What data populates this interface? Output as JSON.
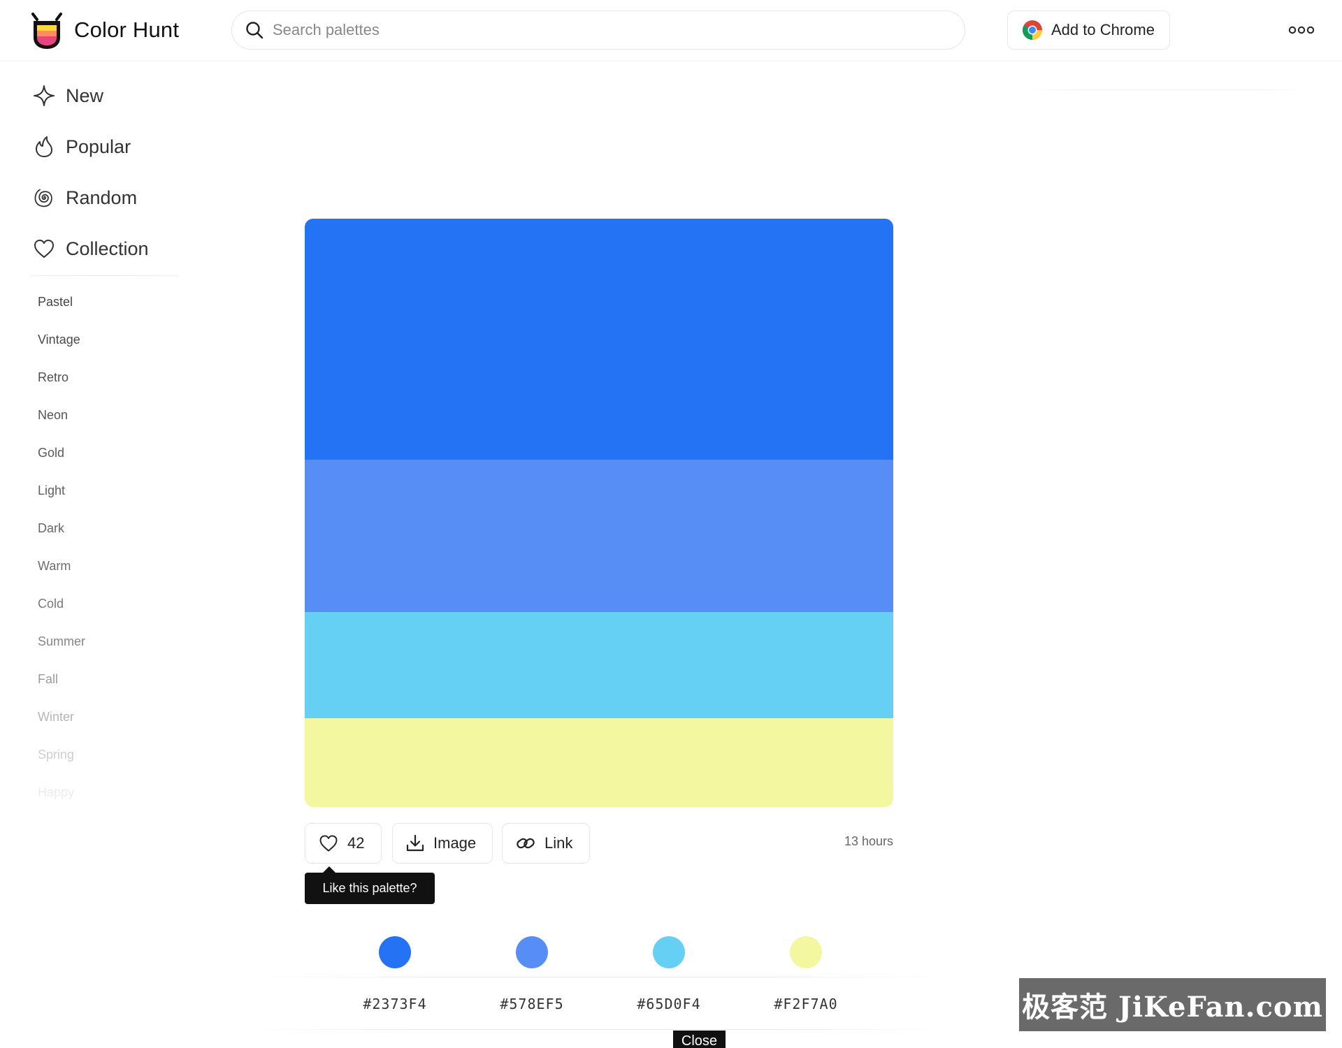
{
  "header": {
    "logo_text": "Color Hunt",
    "search_placeholder": "Search palettes",
    "chrome_button": "Add to Chrome"
  },
  "sidebar": {
    "nav": [
      {
        "label": "New",
        "icon": "sparkle-icon"
      },
      {
        "label": "Popular",
        "icon": "flame-icon"
      },
      {
        "label": "Random",
        "icon": "spiral-icon"
      },
      {
        "label": "Collection",
        "icon": "heart-icon"
      }
    ],
    "tags": [
      "Pastel",
      "Vintage",
      "Retro",
      "Neon",
      "Gold",
      "Light",
      "Dark",
      "Warm",
      "Cold",
      "Summer",
      "Fall",
      "Winter",
      "Spring",
      "Happy"
    ]
  },
  "palette": {
    "colors": [
      "#2373F4",
      "#578EF5",
      "#65D0F4",
      "#F2F7A0"
    ],
    "hex_labels": [
      "#2373F4",
      "#578EF5",
      "#65D0F4",
      "#F2F7A0"
    ]
  },
  "actions": {
    "likes": "42",
    "image_label": "Image",
    "link_label": "Link",
    "time": "13 hours",
    "tooltip": "Like this palette?"
  },
  "close_label": "Close",
  "watermark": "极客范 JiKeFan.com"
}
